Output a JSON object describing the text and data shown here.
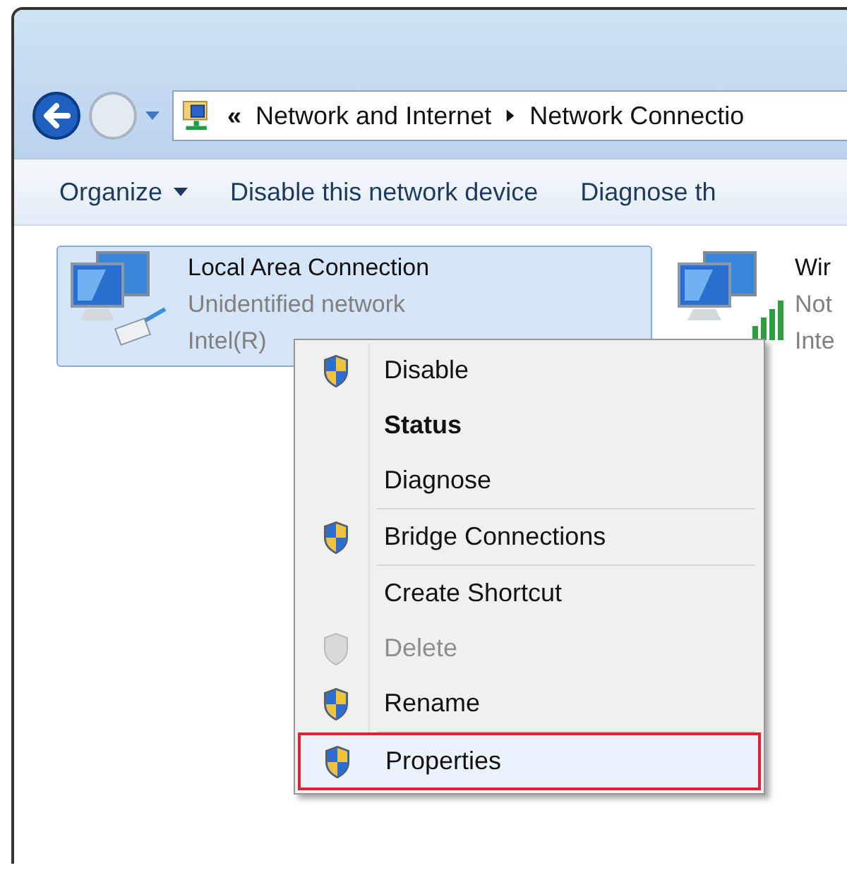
{
  "address_bar": {
    "overflow": "«",
    "crumbs": [
      "Network and Internet",
      "Network Connectio"
    ]
  },
  "toolbar": [
    {
      "label": "Organize",
      "dropdown": true
    },
    {
      "label": "Disable this network device",
      "dropdown": false
    },
    {
      "label": "Diagnose th",
      "dropdown": false
    }
  ],
  "connections": [
    {
      "kind": "wired",
      "name": "Local Area Connection",
      "status": "Unidentified network",
      "adapter": "Intel(R)",
      "selected": true
    },
    {
      "kind": "wireless",
      "name": "Wir",
      "status": "Not",
      "adapter": "Inte",
      "selected": false
    }
  ],
  "context_menu": {
    "groups": [
      {
        "items": [
          {
            "label": "Disable",
            "shield": true,
            "default": false,
            "disabled": false,
            "selected": false
          },
          {
            "label": "Status",
            "shield": false,
            "default": true,
            "disabled": false,
            "selected": false
          },
          {
            "label": "Diagnose",
            "shield": false,
            "default": false,
            "disabled": false,
            "selected": false
          }
        ]
      },
      {
        "items": [
          {
            "label": "Bridge Connections",
            "shield": true,
            "default": false,
            "disabled": false,
            "selected": false
          }
        ]
      },
      {
        "items": [
          {
            "label": "Create Shortcut",
            "shield": false,
            "default": false,
            "disabled": false,
            "selected": false
          },
          {
            "label": "Delete",
            "shield": true,
            "default": false,
            "disabled": true,
            "selected": false
          },
          {
            "label": "Rename",
            "shield": true,
            "default": false,
            "disabled": false,
            "selected": false
          }
        ]
      },
      {
        "items": [
          {
            "label": "Properties",
            "shield": true,
            "default": false,
            "disabled": false,
            "selected": true
          }
        ]
      }
    ]
  }
}
